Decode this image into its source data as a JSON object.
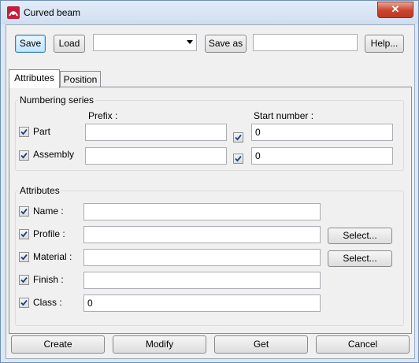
{
  "window": {
    "title": "Curved beam",
    "close_glyph": "✕"
  },
  "toolbar": {
    "save_label": "Save",
    "load_label": "Load",
    "preset_value": "",
    "save_as_label": "Save as",
    "save_as_value": "",
    "help_label": "Help..."
  },
  "tabs": [
    {
      "label": "Attributes",
      "active": true
    },
    {
      "label": "Position",
      "active": false
    }
  ],
  "numbering": {
    "title": "Numbering series",
    "prefix_header": "Prefix :",
    "start_header": "Start number :",
    "rows": [
      {
        "label": "Part",
        "checked": true,
        "prefix": "",
        "start_checked": true,
        "start": "0"
      },
      {
        "label": "Assembly",
        "checked": true,
        "prefix": "",
        "start_checked": true,
        "start": "0"
      }
    ]
  },
  "attributes": {
    "title": "Attributes",
    "select_label": "Select...",
    "rows": [
      {
        "label": "Name :",
        "checked": true,
        "value": ""
      },
      {
        "label": "Profile :",
        "checked": true,
        "value": ""
      },
      {
        "label": "Material :",
        "checked": true,
        "value": ""
      },
      {
        "label": "Finish :",
        "checked": true,
        "value": ""
      },
      {
        "label": "Class :",
        "checked": true,
        "value": "0"
      }
    ]
  },
  "footer": {
    "create_label": "Create",
    "modify_label": "Modify",
    "get_label": "Get",
    "cancel_label": "Cancel"
  },
  "icons": {
    "app": "curved-beam-app-icon",
    "check": "checkmark-icon"
  }
}
